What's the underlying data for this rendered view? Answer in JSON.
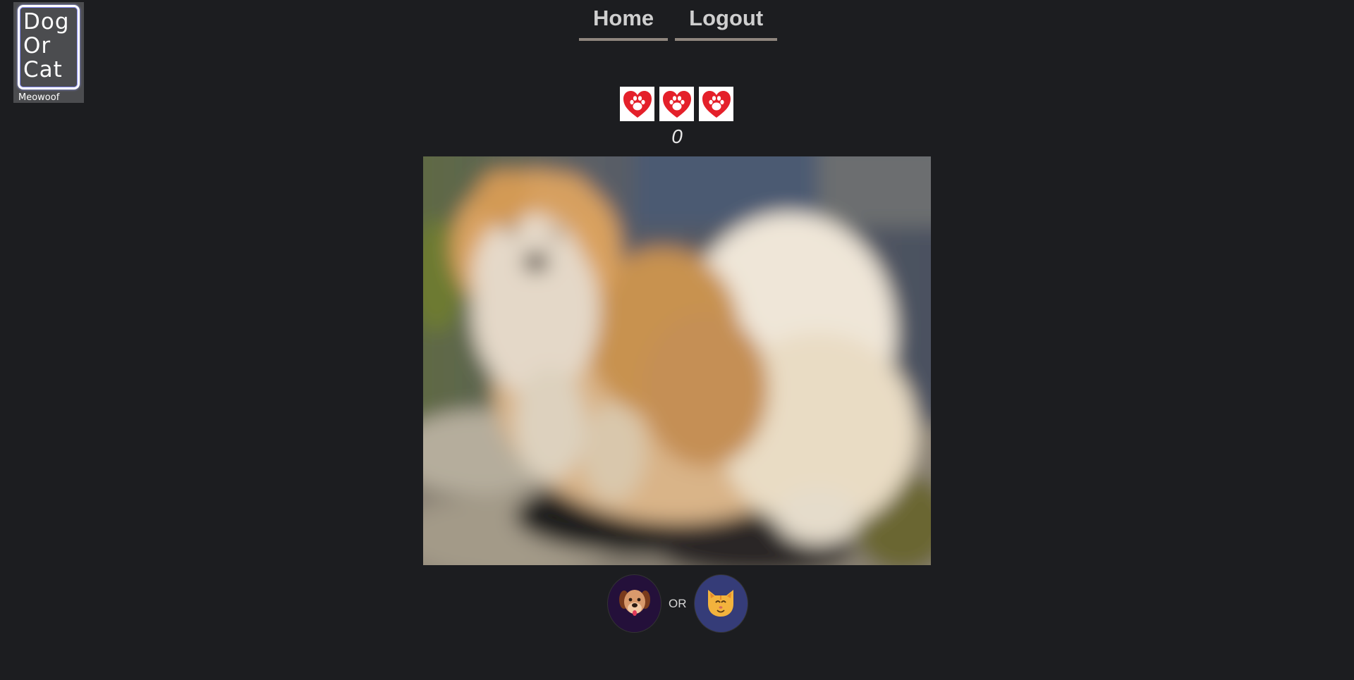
{
  "logo": {
    "lines": [
      "Dog",
      "Or",
      "Cat"
    ],
    "tagline": "Meowoof"
  },
  "nav": {
    "home_label": "Home",
    "logout_label": "Logout"
  },
  "game": {
    "lives": 3,
    "life_icon": "paw-heart-icon",
    "score": "0",
    "photo_icon": "blurred-dog-photo",
    "choice": {
      "dog_icon": "dog-face-icon",
      "or_label": "OR",
      "cat_icon": "cat-face-icon"
    }
  },
  "colors": {
    "background": "#1c1d20",
    "heart": "#e4202a",
    "nav_underline": "#8f867e",
    "dog_button": "#24103a",
    "cat_button": "#353c78"
  }
}
